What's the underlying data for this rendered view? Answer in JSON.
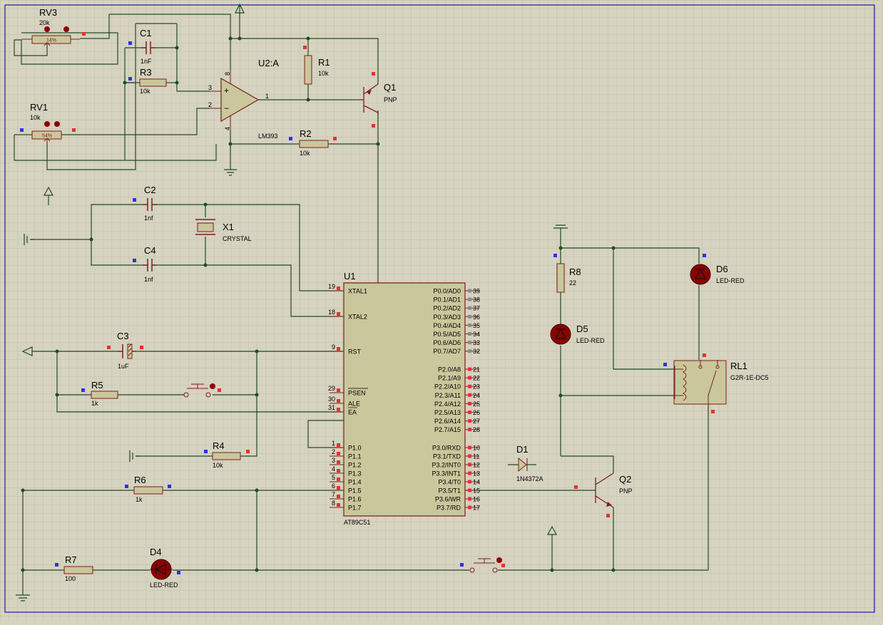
{
  "colors": {
    "background": "#d6d3c0",
    "grid": "#c2bfa9",
    "border": "#1a1aa8",
    "wire": "#1f4d1f",
    "component": "#7a1f1f",
    "body": "#cac79c",
    "pin_red": "#e83030",
    "pin_blue": "#3030e8",
    "led": "#8a0000"
  },
  "components": {
    "rv3": {
      "name": "RV3",
      "value": "20k",
      "percent": "14%"
    },
    "c1": {
      "name": "C1",
      "value": "1nF"
    },
    "r3": {
      "name": "R3",
      "value": "10k"
    },
    "u2a": {
      "name": "U2:A",
      "part": "LM393",
      "pin_plus": "3",
      "pin_minus": "2",
      "pin_out": "1",
      "pin_vcc": "8",
      "pin_gnd": "4"
    },
    "r1": {
      "name": "R1",
      "value": "10k"
    },
    "q1": {
      "name": "Q1",
      "type": "PNP"
    },
    "rv1": {
      "name": "RV1",
      "value": "10k",
      "percent": "54%"
    },
    "r2": {
      "name": "R2",
      "value": "10k"
    },
    "c2": {
      "name": "C2",
      "value": "1nf"
    },
    "x1": {
      "name": "X1",
      "value": "CRYSTAL"
    },
    "c4": {
      "name": "C4",
      "value": "1nf"
    },
    "c3": {
      "name": "C3",
      "value": "1uF"
    },
    "r5": {
      "name": "R5",
      "value": "1k"
    },
    "r4": {
      "name": "R4",
      "value": "10k"
    },
    "r6": {
      "name": "R6",
      "value": "1k"
    },
    "r7": {
      "name": "R7",
      "value": "100"
    },
    "d4": {
      "name": "D4",
      "value": "LED-RED"
    },
    "u1": {
      "name": "U1",
      "part": "AT89C51"
    },
    "d1": {
      "name": "D1",
      "value": "1N4372A"
    },
    "q2": {
      "name": "Q2",
      "type": "PNP"
    },
    "r8": {
      "name": "R8",
      "value": "22"
    },
    "d5": {
      "name": "D5",
      "value": "LED-RED"
    },
    "d6": {
      "name": "D6",
      "value": "LED-RED"
    },
    "rl1": {
      "name": "RL1",
      "value": "G2R-1E-DC5"
    }
  },
  "u1_left_pins": [
    {
      "num": "19",
      "name": "XTAL1"
    },
    {
      "num": "18",
      "name": "XTAL2"
    },
    {
      "num": "9",
      "name": "RST"
    },
    {
      "num": "29",
      "name": "PSEN"
    },
    {
      "num": "30",
      "name": "ALE"
    },
    {
      "num": "31",
      "name": "EA"
    },
    {
      "num": "1",
      "name": "P1.0"
    },
    {
      "num": "2",
      "name": "P1.1"
    },
    {
      "num": "3",
      "name": "P1.2"
    },
    {
      "num": "4",
      "name": "P1.3"
    },
    {
      "num": "5",
      "name": "P1.4"
    },
    {
      "num": "6",
      "name": "P1.5"
    },
    {
      "num": "7",
      "name": "P1.6"
    },
    {
      "num": "8",
      "name": "P1.7"
    }
  ],
  "u1_right_pins": [
    {
      "num": "39",
      "name": "P0.0/AD0"
    },
    {
      "num": "38",
      "name": "P0.1/AD1"
    },
    {
      "num": "37",
      "name": "P0.2/AD2"
    },
    {
      "num": "36",
      "name": "P0.3/AD3"
    },
    {
      "num": "35",
      "name": "P0.4/AD4"
    },
    {
      "num": "34",
      "name": "P0.5/AD5"
    },
    {
      "num": "33",
      "name": "P0.6/AD6"
    },
    {
      "num": "32",
      "name": "P0.7/AD7"
    },
    {
      "num": "21",
      "name": "P2.0/A8"
    },
    {
      "num": "22",
      "name": "P2.1/A9"
    },
    {
      "num": "23",
      "name": "P2.2/A10"
    },
    {
      "num": "24",
      "name": "P2.3/A11"
    },
    {
      "num": "25",
      "name": "P2.4/A12"
    },
    {
      "num": "26",
      "name": "P2.5/A13"
    },
    {
      "num": "27",
      "name": "P2.6/A14"
    },
    {
      "num": "28",
      "name": "P2.7/A15"
    },
    {
      "num": "10",
      "name": "P3.0/RXD"
    },
    {
      "num": "11",
      "name": "P3.1/TXD"
    },
    {
      "num": "12",
      "name": "P3.2/INT0"
    },
    {
      "num": "13",
      "name": "P3.3/INT1"
    },
    {
      "num": "14",
      "name": "P3.4/T0"
    },
    {
      "num": "15",
      "name": "P3.5/T1"
    },
    {
      "num": "16",
      "name": "P3.6/WR"
    },
    {
      "num": "17",
      "name": "P3.7/RD"
    }
  ]
}
